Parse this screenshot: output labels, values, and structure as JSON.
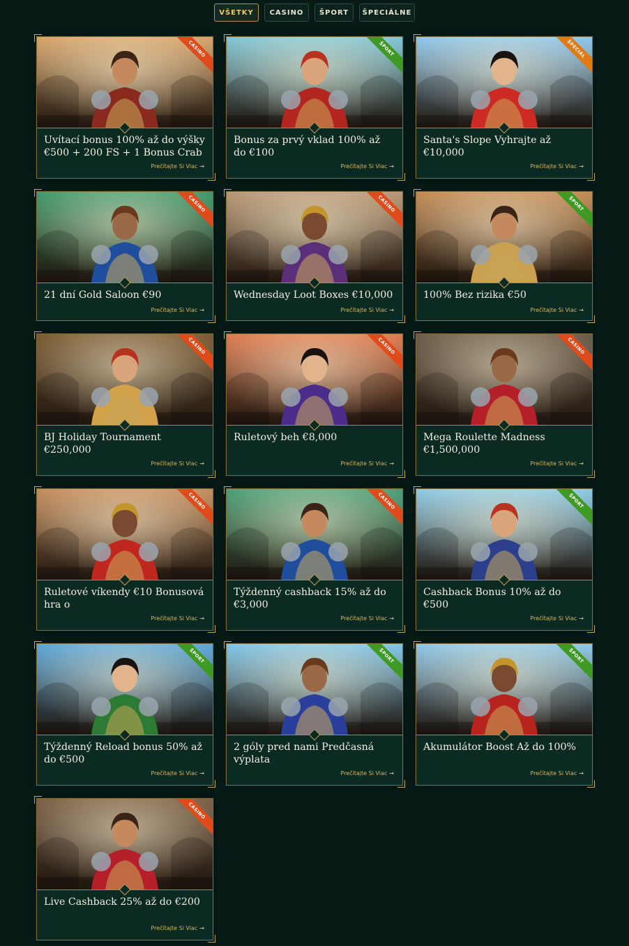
{
  "tabs": [
    {
      "label": "VŠETKY",
      "active": true
    },
    {
      "label": "CASINO",
      "active": false
    },
    {
      "label": "ŠPORT",
      "active": false
    },
    {
      "label": "ŠPECIÁLNE",
      "active": false
    }
  ],
  "read_more_label": "Prečítajte Si Viac",
  "read_more_arrow": "→",
  "ribbon_colors": {
    "CASINO": "#e04b1c",
    "ŠPORT": "#3e9a22",
    "ŠPECIÁL": "#e07a14"
  },
  "cards": [
    {
      "title": "Uvítací bonus 100% až do výšky €500 + 200 FS + 1 Bonus Crab",
      "tag": "CASINO",
      "art": "king",
      "sky": "#d8a46a",
      "accent": "#8a2a1e"
    },
    {
      "title": "Bonus za prvý vklad 100% až do €100",
      "tag": "ŠPORT",
      "art": "gladiator",
      "sky": "#7fc7d8",
      "accent": "#b3261f"
    },
    {
      "title": "Santa's Slope Vyhrajte až €10,000",
      "tag": "ŠPECIÁL",
      "art": "santa",
      "sky": "#8ec8ef",
      "accent": "#cc2a22"
    },
    {
      "title": "21 dní Gold Saloon €90",
      "tag": "CASINO",
      "art": "saloon-woman",
      "sky": "#3f9a6c",
      "accent": "#1f4e9c"
    },
    {
      "title": "Wednesday Loot Boxes €10,000",
      "tag": "CASINO",
      "art": "loot-woman",
      "sky": "#b89774",
      "accent": "#5b2e7a"
    },
    {
      "title": "100% Bez rizika €50",
      "tag": "ŠPORT",
      "art": "knight",
      "sky": "#c38a54",
      "accent": "#c9a150"
    },
    {
      "title": "BJ Holiday Tournament €250,000",
      "tag": "CASINO",
      "art": "bj-woman",
      "sky": "#7a5a33",
      "accent": "#d2a24a"
    },
    {
      "title": "Ruletový beh €8,000",
      "tag": "CASINO",
      "art": "warrior-back",
      "sky": "#e07a4e",
      "accent": "#4b2c8a"
    },
    {
      "title": "Mega Roulette Madness €1,500,000",
      "tag": "CASINO",
      "art": "roulette-woman",
      "sky": "#6b5a47",
      "accent": "#b51f2a"
    },
    {
      "title": "Ruletové víkendy €10 Bonusová hra o",
      "tag": "CASINO",
      "art": "caped-woman",
      "sky": "#c58c5c",
      "accent": "#c0281f"
    },
    {
      "title": "Týždenný cashback 15% až do €3,000",
      "tag": "CASINO",
      "art": "cashback-woman",
      "sky": "#4aa078",
      "accent": "#1f4e9c"
    },
    {
      "title": "Cashback Bonus 10% až do €500",
      "tag": "ŠPORT",
      "art": "arena-man",
      "sky": "#8ccbe8",
      "accent": "#2c3f8c"
    },
    {
      "title": "Týždenný Reload bonus 50% až do €500",
      "tag": "ŠPORT",
      "art": "football-king",
      "sky": "#5aa8dc",
      "accent": "#2d7a34"
    },
    {
      "title": "2 góly pred nami Predčasná výplata",
      "tag": "ŠPORT",
      "art": "crowned-player",
      "sky": "#7ec6ea",
      "accent": "#2a3f9c"
    },
    {
      "title": "Akumulátor Boost Až do 100%",
      "tag": "ŠPORT",
      "art": "tennis-man",
      "sky": "#8dc8ea",
      "accent": "#b8241d"
    },
    {
      "title": "Live Cashback 25% až do €200",
      "tag": "CASINO",
      "art": "live-woman",
      "sky": "#7a5e45",
      "accent": "#b51f2a"
    }
  ]
}
